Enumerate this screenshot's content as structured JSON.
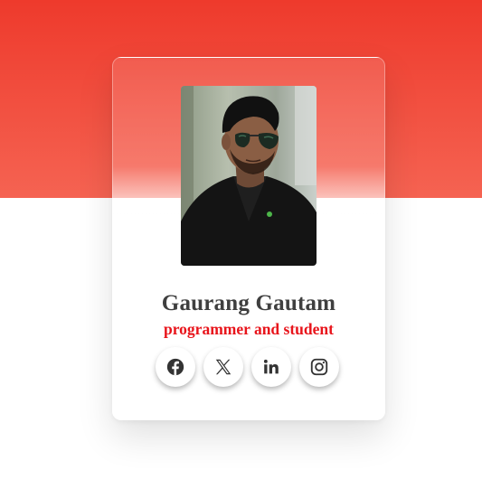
{
  "profile": {
    "name": "Gaurang Gautam",
    "role": "programmer and student",
    "photo_alt": "Gaurang Gautam"
  },
  "socials": [
    {
      "icon": "facebook-icon",
      "label": "Facebook"
    },
    {
      "icon": "x-icon",
      "label": "X"
    },
    {
      "icon": "linkedin-icon",
      "label": "LinkedIn"
    },
    {
      "icon": "instagram-icon",
      "label": "Instagram"
    }
  ],
  "colors": {
    "band_top": "#ee3a2c",
    "band_bottom": "#f56352",
    "name": "#3f3f3f",
    "role": "#e8141b",
    "icon": "#333333"
  }
}
